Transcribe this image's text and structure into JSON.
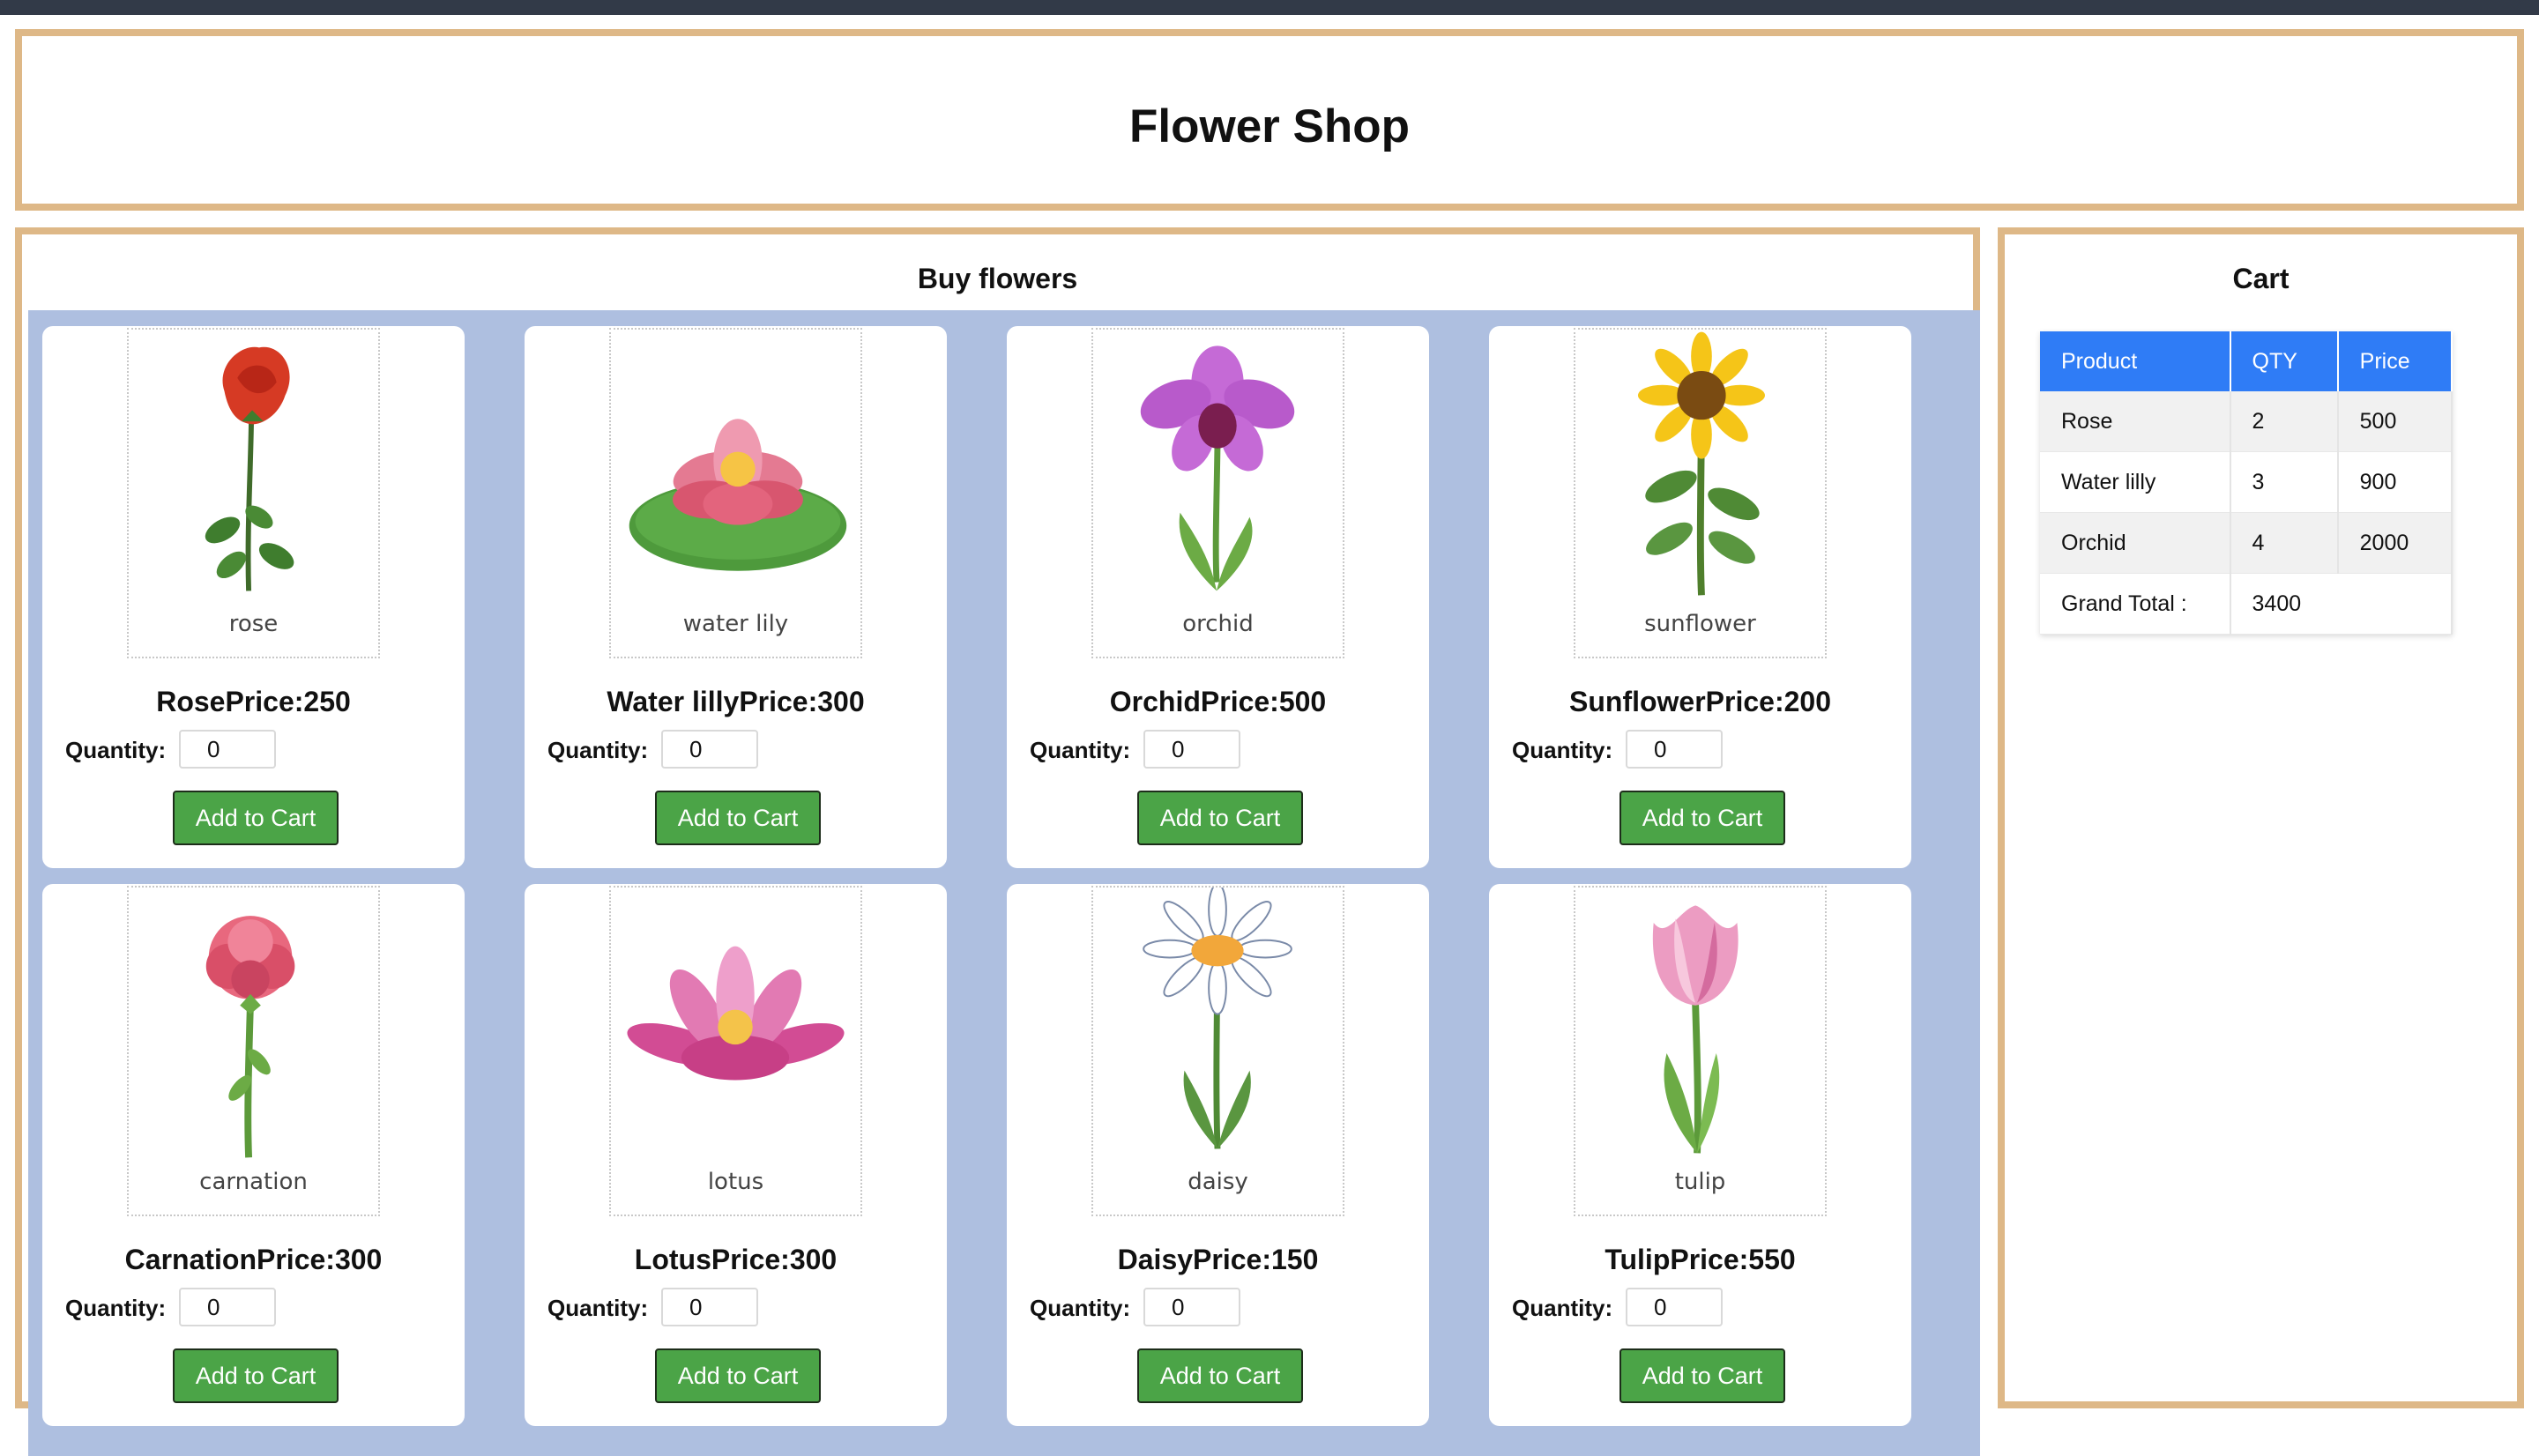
{
  "header": {
    "title": "Flower Shop"
  },
  "shop": {
    "title": "Buy flowers",
    "quantity_label": "Quantity:",
    "add_button_label": "Add to Cart",
    "products": [
      {
        "name": "Rose",
        "price": "250",
        "title": "RosePrice:250",
        "image_caption": "rose",
        "quantity": "0"
      },
      {
        "name": "Water lilly",
        "price": "300",
        "title": "Water lillyPrice:300",
        "image_caption": "water lily",
        "quantity": "0"
      },
      {
        "name": "Orchid",
        "price": "500",
        "title": "OrchidPrice:500",
        "image_caption": "orchid",
        "quantity": "0"
      },
      {
        "name": "Sunflower",
        "price": "200",
        "title": "SunflowerPrice:200",
        "image_caption": "sunflower",
        "quantity": "0"
      },
      {
        "name": "Carnation",
        "price": "300",
        "title": "CarnationPrice:300",
        "image_caption": "carnation",
        "quantity": "0"
      },
      {
        "name": "Lotus",
        "price": "300",
        "title": "LotusPrice:300",
        "image_caption": "lotus",
        "quantity": "0"
      },
      {
        "name": "Daisy",
        "price": "150",
        "title": "DaisyPrice:150",
        "image_caption": "daisy",
        "quantity": "0"
      },
      {
        "name": "Tulip",
        "price": "550",
        "title": "TulipPrice:550",
        "image_caption": "tulip",
        "quantity": "0"
      }
    ]
  },
  "cart": {
    "title": "Cart",
    "columns": [
      "Product",
      "QTY",
      "Price"
    ],
    "rows": [
      {
        "product": "Rose",
        "qty": "2",
        "price": "500"
      },
      {
        "product": "Water lilly",
        "qty": "3",
        "price": "900"
      },
      {
        "product": "Orchid",
        "qty": "4",
        "price": "2000"
      }
    ],
    "grand_total_label": "Grand Total :",
    "grand_total_value": "3400"
  },
  "colors": {
    "panel_border": "#deb887",
    "grid_background": "#aebfe0",
    "button_green": "#4ba447",
    "table_header_blue": "#2f7cf6",
    "top_bar": "#323a48"
  }
}
